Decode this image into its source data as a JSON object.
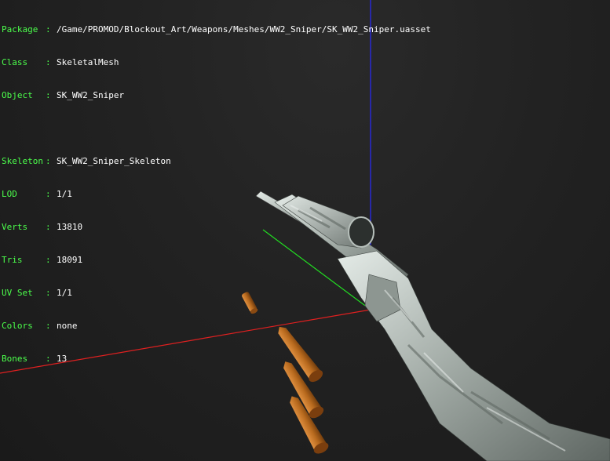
{
  "info_panel": {
    "package": {
      "key": "Package",
      "value": "/Game/PROMOD/Blockout_Art/Weapons/Meshes/WW2_Sniper/SK_WW2_Sniper.uasset"
    },
    "class": {
      "key": "Class",
      "value": "SkeletalMesh"
    },
    "object": {
      "key": "Object",
      "value": "SK_WW2_Sniper"
    },
    "skeleton": {
      "key": "Skeleton",
      "value": "SK_WW2_Sniper_Skeleton"
    },
    "lod": {
      "key": "LOD",
      "value": "1/1"
    },
    "verts": {
      "key": "Verts",
      "value": "13810"
    },
    "tris": {
      "key": "Tris",
      "value": "18091"
    },
    "uv_set": {
      "key": "UV Set",
      "value": "1/1"
    },
    "colors": {
      "key": "Colors",
      "value": "none"
    },
    "bones": {
      "key": "Bones",
      "value": "13"
    },
    "separator": ":"
  },
  "scene": {
    "axis_colors": {
      "x": "#ff2020",
      "y": "#20ff20",
      "z": "#2020ff"
    },
    "mesh_color": "#c9d0cc",
    "bullet_color": "#b86a1e"
  }
}
